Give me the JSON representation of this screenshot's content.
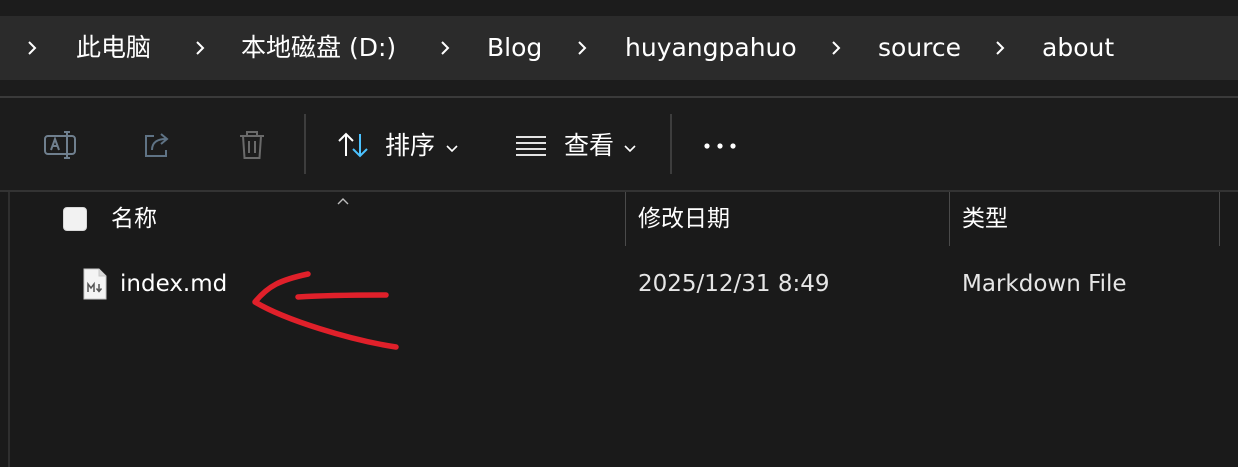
{
  "breadcrumb": {
    "items": [
      "此电脑",
      "本地磁盘 (D:)",
      "Blog",
      "huyangpahuo",
      "source",
      "about"
    ]
  },
  "toolbar": {
    "sort_label": "排序",
    "view_label": "查看",
    "icons": [
      "rename-icon",
      "share-icon",
      "delete-icon",
      "sort-icon",
      "view-list-icon",
      "more-icon"
    ]
  },
  "columns": {
    "name": "名称",
    "modified": "修改日期",
    "type": "类型"
  },
  "files": [
    {
      "name": "index.md",
      "modified": "2025/12/31 8:49",
      "type": "Markdown File"
    }
  ],
  "colors": {
    "background": "#1a1a1a",
    "address_bar": "#2b2b2b",
    "sort_icon_accent": "#4cc2ff",
    "annotation": "#e0202a"
  }
}
